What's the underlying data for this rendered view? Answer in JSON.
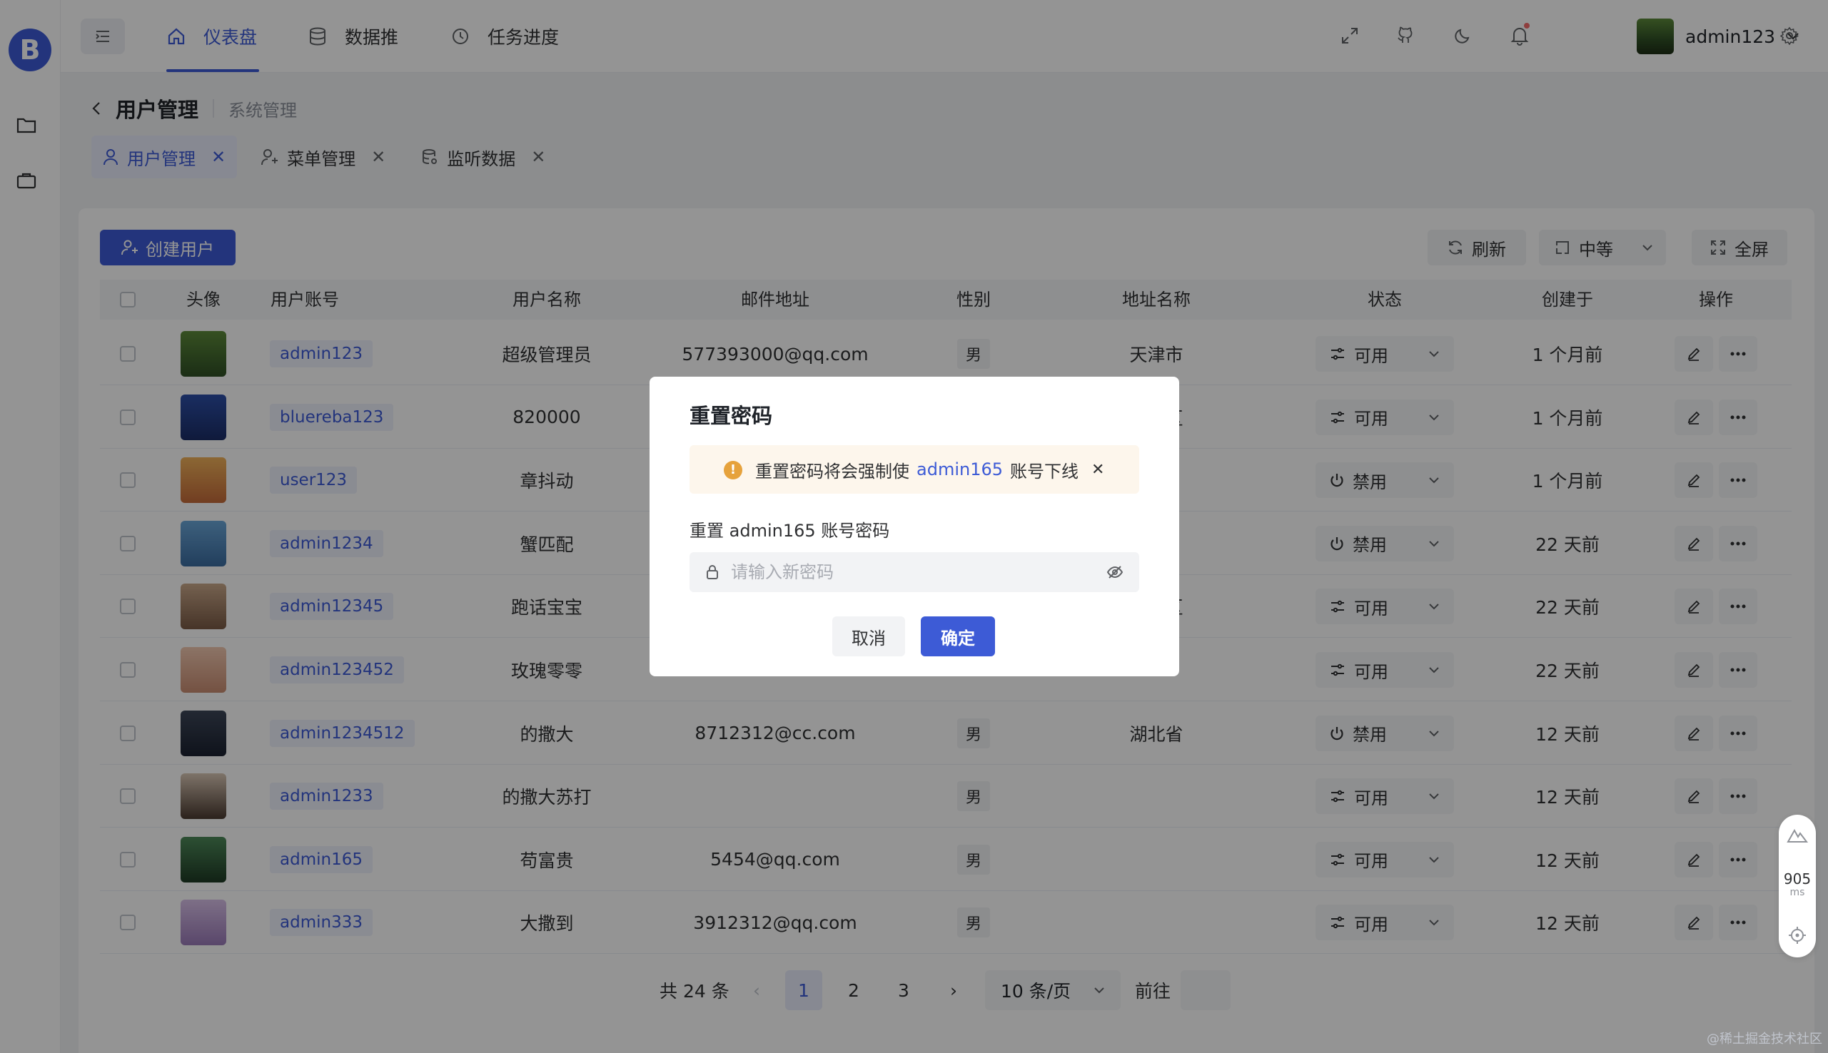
{
  "sidebar": {
    "logo_letter": "B",
    "icons": [
      "folder-icon",
      "briefcase-icon"
    ]
  },
  "header": {
    "nav": [
      {
        "label": "仪表盘",
        "icon": "home-icon",
        "active": true
      },
      {
        "label": "数据推",
        "icon": "database-icon",
        "active": false
      },
      {
        "label": "任务进度",
        "icon": "progress-icon",
        "active": false
      }
    ],
    "user_name": "admin123"
  },
  "breadcrumb": {
    "title": "用户管理",
    "parent": "系统管理"
  },
  "tabs": [
    {
      "label": "用户管理",
      "active": true
    },
    {
      "label": "菜单管理",
      "active": false
    },
    {
      "label": "监听数据",
      "active": false
    }
  ],
  "toolbar": {
    "create_label": "创建用户",
    "refresh_label": "刷新",
    "size_label": "中等",
    "fullscreen_label": "全屏"
  },
  "table": {
    "columns": [
      "头像",
      "用户账号",
      "用户名称",
      "邮件地址",
      "性别",
      "地址名称",
      "状态",
      "创建于",
      "操作"
    ],
    "rows": [
      {
        "account": "admin123",
        "name": "超级管理员",
        "email": "577393000@qq.com",
        "gender": "男",
        "address": "天津市",
        "status": "可用",
        "created": "1 个月前"
      },
      {
        "account": "bluereba123",
        "name": "820000",
        "email": "",
        "gender": "",
        "address": "行政区",
        "status": "可用",
        "created": "1 个月前"
      },
      {
        "account": "user123",
        "name": "章抖动",
        "email": "",
        "gender": "",
        "address": "",
        "status": "禁用",
        "created": "1 个月前"
      },
      {
        "account": "admin1234",
        "name": "蟹匹配",
        "email": "",
        "gender": "",
        "address": "",
        "status": "禁用",
        "created": "22 天前"
      },
      {
        "account": "admin12345",
        "name": "跑话宝宝",
        "email": "",
        "gender": "",
        "address": "自治区",
        "status": "可用",
        "created": "22 天前"
      },
      {
        "account": "admin123452",
        "name": "玫瑰零零",
        "email": "",
        "gender": "",
        "address": "",
        "status": "可用",
        "created": "22 天前"
      },
      {
        "account": "admin1234512",
        "name": "的撒大",
        "email": "8712312@cc.com",
        "gender": "男",
        "address": "湖北省",
        "status": "禁用",
        "created": "12 天前"
      },
      {
        "account": "admin1233",
        "name": "的撒大苏打",
        "email": "",
        "gender": "男",
        "address": "",
        "status": "可用",
        "created": "12 天前"
      },
      {
        "account": "admin165",
        "name": "苟富贵",
        "email": "5454@qq.com",
        "gender": "男",
        "address": "",
        "status": "可用",
        "created": "12 天前"
      },
      {
        "account": "admin333",
        "name": "大撒到",
        "email": "3912312@qq.com",
        "gender": "男",
        "address": "",
        "status": "可用",
        "created": "12 天前"
      }
    ]
  },
  "pagination": {
    "total": "共 24 条",
    "pages": [
      "1",
      "2",
      "3"
    ],
    "current": "1",
    "page_size": "10 条/页",
    "goto_label": "前往"
  },
  "widget": {
    "value": "905",
    "unit": "ms"
  },
  "watermark": "@稀土掘金技术社区",
  "dialog": {
    "title": "重置密码",
    "alert_prefix": "重置密码将会强制使",
    "alert_user": "admin165",
    "alert_suffix": "账号下线",
    "label": "重置 admin165 账号密码",
    "password_placeholder": "请输入新密码",
    "password_value": "",
    "cancel_label": "取消",
    "confirm_label": "确定"
  },
  "colors": {
    "primary": "#3d5bd6",
    "warning": "#e6a23c",
    "warning_bg": "#fdf6ec"
  }
}
